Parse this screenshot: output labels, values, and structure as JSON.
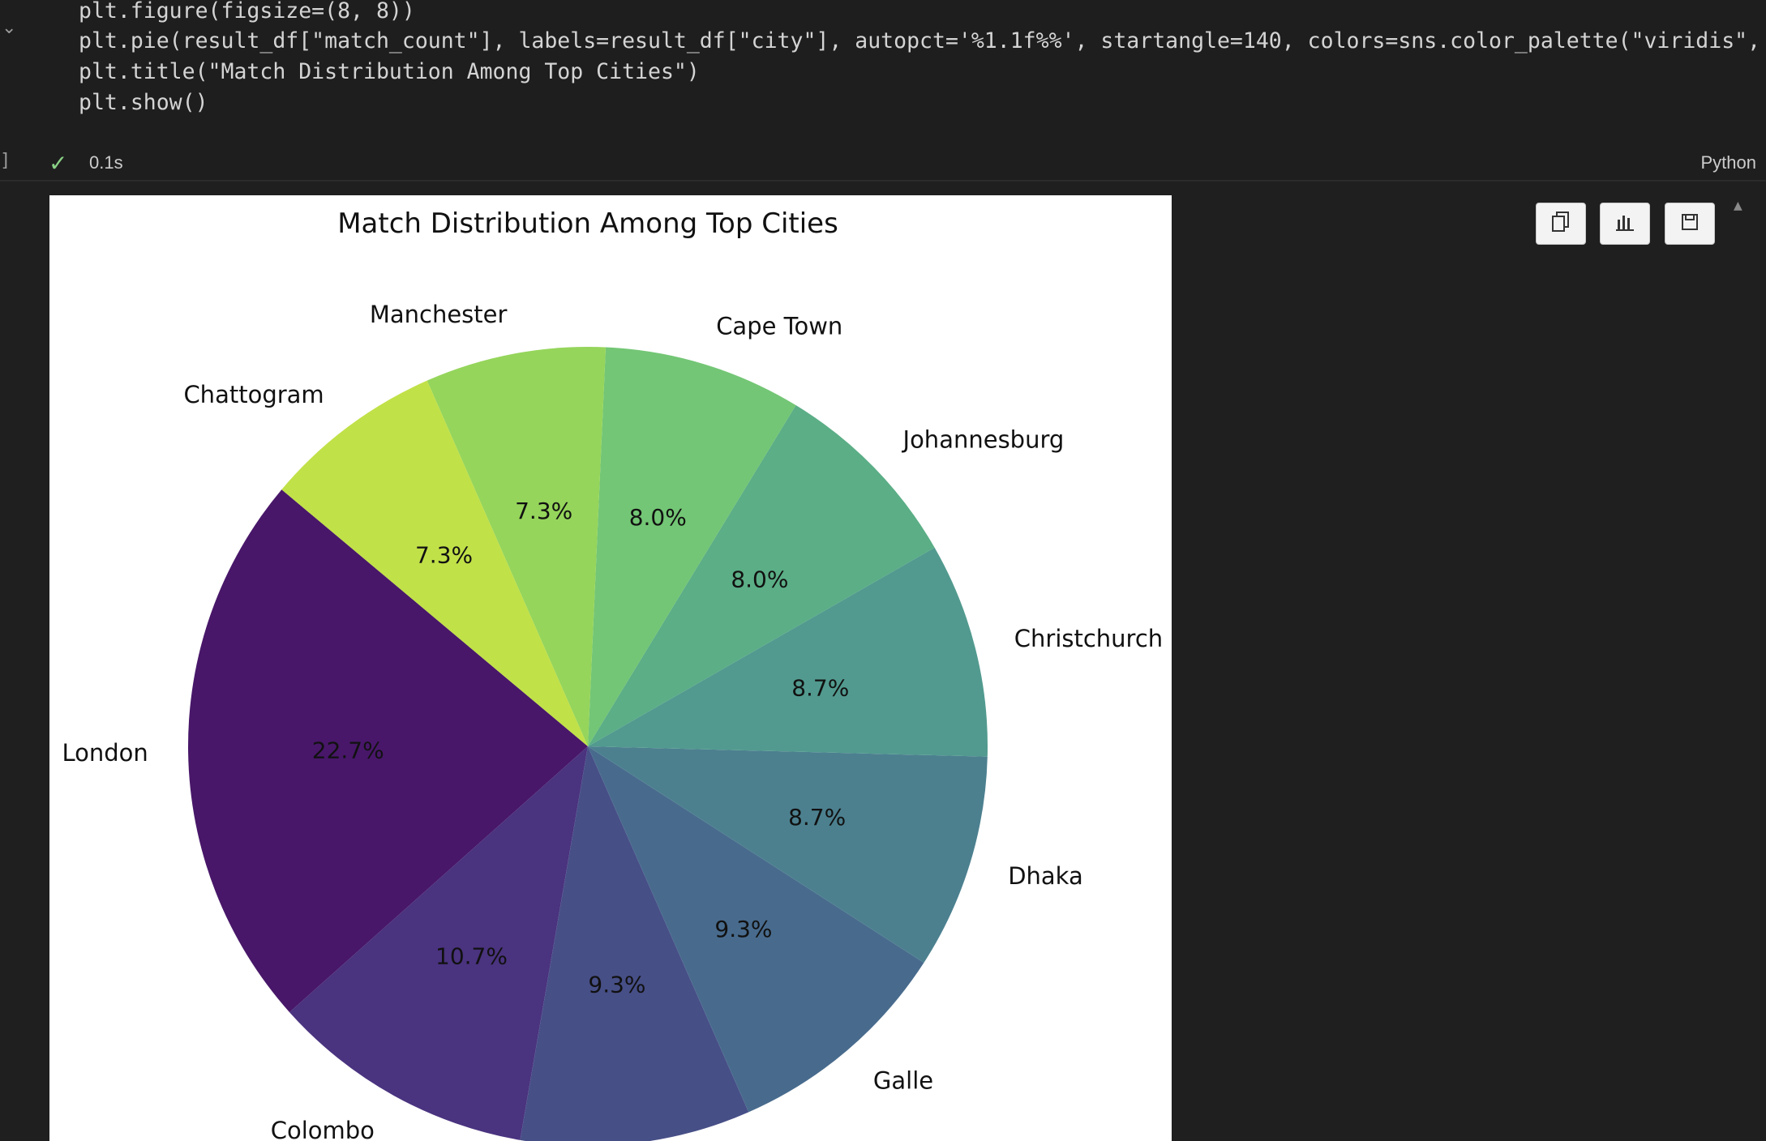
{
  "code_cell": {
    "lines": [
      "plt.figure(figsize=(8, 8))",
      "plt.pie(result_df[\"match_count\"], labels=result_df[\"city\"], autopct='%1.1f%%', startangle=140, colors=sns.color_palette(\"viridis\", len(",
      "plt.title(\"Match Distribution Among Top Cities\")",
      "plt.show()"
    ],
    "status_icon": "check-icon",
    "exec_time": "0.1s",
    "language": "Python"
  },
  "output_toolbar": {
    "buttons": [
      {
        "icon": "copy-icon"
      },
      {
        "icon": "chart-icon"
      },
      {
        "icon": "save-icon"
      }
    ]
  },
  "chart_data": {
    "type": "pie",
    "title": "Match Distribution Among Top Cities",
    "start_angle": 140,
    "labels": [
      "London",
      "Colombo",
      "Galle",
      "Dhaka",
      "Christchurch",
      "Johannesburg",
      "Cape Town",
      "Manchester",
      "Chattogram"
    ],
    "values": [
      22.7,
      10.7,
      9.3,
      9.3,
      8.7,
      8.7,
      8.0,
      8.0,
      7.3,
      7.3
    ],
    "slices": [
      {
        "label": "London",
        "value": 22.7,
        "pct": "22.7%",
        "color": "#481769"
      },
      {
        "label": "Colombo",
        "value": 10.7,
        "pct": "10.7%",
        "color": "#4a337f"
      },
      {
        "label": "",
        "value": 9.3,
        "pct": "9.3%",
        "color": "#474f87"
      },
      {
        "label": "Galle",
        "value": 9.3,
        "pct": "9.3%",
        "color": "#486b8d"
      },
      {
        "label": "Dhaka",
        "value": 8.7,
        "pct": "8.7%",
        "color": "#4c808f"
      },
      {
        "label": "Christchurch",
        "value": 8.7,
        "pct": "8.7%",
        "color": "#529a8f"
      },
      {
        "label": "Johannesburg",
        "value": 8.0,
        "pct": "8.0%",
        "color": "#5bae86"
      },
      {
        "label": "Cape Town",
        "value": 8.0,
        "pct": "8.0%",
        "color": "#73c675"
      },
      {
        "label": "Manchester",
        "value": 7.3,
        "pct": "7.3%",
        "color": "#95d55b"
      },
      {
        "label": "Chattogram",
        "value": 7.3,
        "pct": "7.3%",
        "color": "#c1e148"
      }
    ]
  }
}
